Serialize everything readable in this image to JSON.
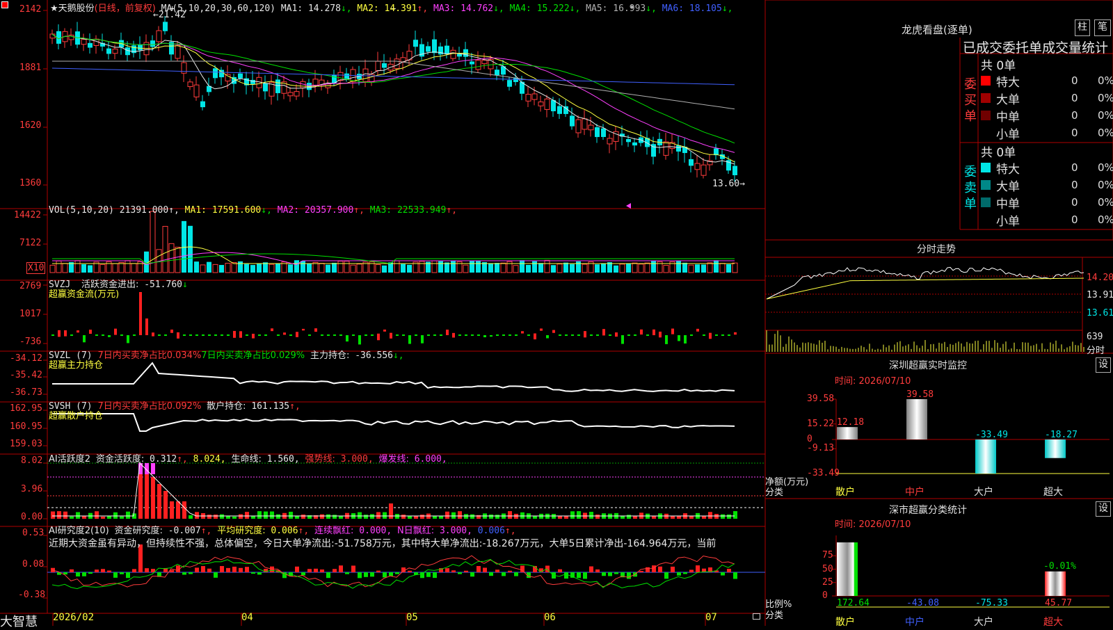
{
  "app": {
    "logo": "大智慧",
    "corner_icon": "menu-square-icon"
  },
  "kline": {
    "stock_name": "★天鹅股份",
    "mode": "(日线，前复权)",
    "ma_label": "MA(5,10,20,30,60,120)",
    "ma": [
      {
        "label": "MA1:",
        "value": "14.278",
        "arrow": "↓",
        "color": "#e8e8e8"
      },
      {
        "label": "MA2:",
        "value": "14.391",
        "arrow": "↑",
        "color": "#ffff40"
      },
      {
        "label": "MA3:",
        "value": "14.762",
        "arrow": "↓",
        "color": "#ff40ff"
      },
      {
        "label": "MA4:",
        "value": "15.222",
        "arrow": "↓",
        "color": "#00e000"
      },
      {
        "label": "MA5:",
        "value": "16.993",
        "arrow": "↓",
        "color": "#b0b0b0"
      },
      {
        "label": "MA6:",
        "value": "18.105",
        "arrow": "↓",
        "color": "#4060ff"
      }
    ],
    "y_ticks": [
      "2142",
      "1881",
      "1620",
      "1360"
    ],
    "high_marker": "21.42",
    "low_marker": "13.60"
  },
  "vol": {
    "label": "VOL(5,10,20)",
    "value": "21391.000",
    "ma": [
      {
        "label": "MA1:",
        "value": "17591.600",
        "arrow": "↓",
        "color": "#ffff40"
      },
      {
        "label": "MA2:",
        "value": "20357.900",
        "arrow": "↑",
        "color": "#ff40ff"
      },
      {
        "label": "MA3:",
        "value": "22533.949",
        "arrow": "↑",
        "color": "#00e000"
      }
    ],
    "y_ticks": [
      "14422",
      "7122"
    ],
    "multiplier": "X10"
  },
  "svzj": {
    "label": "SVZJ",
    "title": "活跃资金进出:",
    "value": "-51.760",
    "arrow": "↓",
    "subtitle": "超赢资金流(万元)",
    "y_ticks": [
      "2769",
      "1017",
      "-736"
    ]
  },
  "svzl": {
    "label": "SVZL (7)",
    "t1": "7日内买卖净占比0.034%",
    "t2": "7日内买卖净占比0.029%",
    "t3": "主力持仓:",
    "value": "-36.556",
    "arrow": "↓,",
    "subtitle": "超赢主力持仓",
    "y_ticks": [
      "-34.12",
      "-35.42",
      "-36.73"
    ]
  },
  "svsh": {
    "label": "SVSH (7)",
    "t1": "7日内买卖净占比0.092%",
    "t2": "散户持仓:",
    "value": "161.135",
    "arrow": "↑,",
    "subtitle": "超赢散户持仓",
    "y_ticks": [
      "162.95",
      "160.95",
      "159.03"
    ]
  },
  "ai_active": {
    "label": "AI活跃度2",
    "t1": "资金活跃度:",
    "v1": "0.312",
    "a1": "↑,",
    "v2": "8.024,",
    "t3": "生命线:",
    "v3": "1.560,",
    "t4": "强势线:",
    "v4": "3.000,",
    "t5": "爆发线:",
    "v5": "6.000,",
    "y_ticks": [
      "8.02",
      "3.96",
      "0.00"
    ]
  },
  "ai_research": {
    "label": "AI研究度2(10)",
    "t1": "资金研究度:",
    "v1": "-0.007",
    "a1": "↑,",
    "t2": "平均研究度:",
    "v2": "0.006",
    "a2": "↑,",
    "t3": "连续飘红:",
    "v3": "0.000,",
    "t4": "N日飘红:",
    "v4": "3.000,",
    "v5": "0.006",
    "a5": "↑,",
    "commentary": "近期大资金虽有异动，但持续性不强，总体偏空，今日大单净流出:-51.758万元，其中特大单净流出:-18.267万元，大单5日累计净出-164.964万元，当前",
    "y_ticks": [
      "0.53",
      "0.08",
      "-0.38"
    ]
  },
  "time_axis": [
    "2026/02",
    "04",
    "05",
    "06",
    "07"
  ],
  "orders": {
    "title": "龙虎看盘(逐单)",
    "btn_bar": "柱",
    "btn_tick": "笔",
    "header": "已成交委托单成交量统计",
    "buy_label": "委买单",
    "sell_label": "委卖单",
    "buy_total": "共 0单",
    "sell_total": "共 0单",
    "buy_rows": [
      {
        "name": "特大",
        "count": "0",
        "pct": "0%",
        "color": "#ff0000"
      },
      {
        "name": "大单",
        "count": "0",
        "pct": "0%",
        "color": "#a00000"
      },
      {
        "name": "中单",
        "count": "0",
        "pct": "0%",
        "color": "#700000"
      },
      {
        "name": "小单",
        "count": "0",
        "pct": "0%",
        "color": ""
      }
    ],
    "sell_rows": [
      {
        "name": "特大",
        "count": "0",
        "pct": "0%",
        "color": "#00e6e6"
      },
      {
        "name": "大单",
        "count": "0",
        "pct": "0%",
        "color": "#008888"
      },
      {
        "name": "中单",
        "count": "0",
        "pct": "0%",
        "color": "#006a6a"
      },
      {
        "name": "小单",
        "count": "0",
        "pct": "0%",
        "color": ""
      }
    ]
  },
  "intraday": {
    "title": "分时走势",
    "price_ticks": [
      "14.20",
      "13.91",
      "13.61"
    ],
    "vol_tick": "639",
    "vol_label": "分时"
  },
  "monitor": {
    "title": "深圳超赢实时监控",
    "btn": "设",
    "time": "时间: 2026/07/10",
    "y_ticks": [
      "39.58",
      "15.22",
      "0",
      "-9.13",
      "-33.49"
    ],
    "y_label": "净额(万元)",
    "x_label": "分类",
    "categories": [
      "散户",
      "中户",
      "大户",
      "超大"
    ],
    "values": [
      "12.18",
      "39.58",
      "-33.49",
      "-18.27"
    ]
  },
  "classify": {
    "title": "深市超赢分类统计",
    "btn": "设",
    "time": "时间: 2026/07/10",
    "y_ticks": [
      "75",
      "50",
      "25",
      "0"
    ],
    "y_label": "比例%",
    "x_label": "分类",
    "categories": [
      "散户",
      "中户",
      "大户",
      "超大"
    ],
    "values": [
      "172.64",
      "-43.08",
      "-75.33",
      "45.77"
    ],
    "annot": "-0.01%"
  }
}
